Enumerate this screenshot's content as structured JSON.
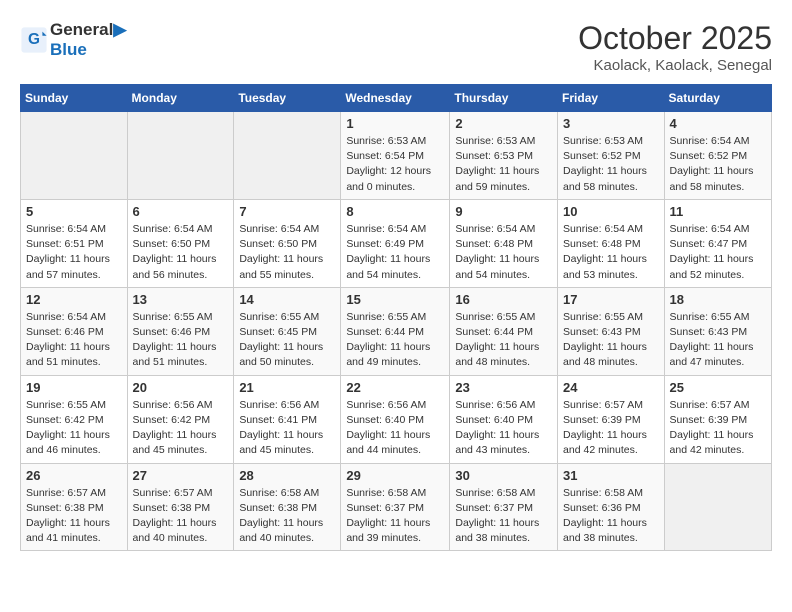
{
  "logo": {
    "line1": "General",
    "line2": "Blue"
  },
  "title": "October 2025",
  "location": "Kaolack, Kaolack, Senegal",
  "weekdays": [
    "Sunday",
    "Monday",
    "Tuesday",
    "Wednesday",
    "Thursday",
    "Friday",
    "Saturday"
  ],
  "weeks": [
    [
      {
        "day": "",
        "info": ""
      },
      {
        "day": "",
        "info": ""
      },
      {
        "day": "",
        "info": ""
      },
      {
        "day": "1",
        "info": "Sunrise: 6:53 AM\nSunset: 6:54 PM\nDaylight: 12 hours\nand 0 minutes."
      },
      {
        "day": "2",
        "info": "Sunrise: 6:53 AM\nSunset: 6:53 PM\nDaylight: 11 hours\nand 59 minutes."
      },
      {
        "day": "3",
        "info": "Sunrise: 6:53 AM\nSunset: 6:52 PM\nDaylight: 11 hours\nand 58 minutes."
      },
      {
        "day": "4",
        "info": "Sunrise: 6:54 AM\nSunset: 6:52 PM\nDaylight: 11 hours\nand 58 minutes."
      }
    ],
    [
      {
        "day": "5",
        "info": "Sunrise: 6:54 AM\nSunset: 6:51 PM\nDaylight: 11 hours\nand 57 minutes."
      },
      {
        "day": "6",
        "info": "Sunrise: 6:54 AM\nSunset: 6:50 PM\nDaylight: 11 hours\nand 56 minutes."
      },
      {
        "day": "7",
        "info": "Sunrise: 6:54 AM\nSunset: 6:50 PM\nDaylight: 11 hours\nand 55 minutes."
      },
      {
        "day": "8",
        "info": "Sunrise: 6:54 AM\nSunset: 6:49 PM\nDaylight: 11 hours\nand 54 minutes."
      },
      {
        "day": "9",
        "info": "Sunrise: 6:54 AM\nSunset: 6:48 PM\nDaylight: 11 hours\nand 54 minutes."
      },
      {
        "day": "10",
        "info": "Sunrise: 6:54 AM\nSunset: 6:48 PM\nDaylight: 11 hours\nand 53 minutes."
      },
      {
        "day": "11",
        "info": "Sunrise: 6:54 AM\nSunset: 6:47 PM\nDaylight: 11 hours\nand 52 minutes."
      }
    ],
    [
      {
        "day": "12",
        "info": "Sunrise: 6:54 AM\nSunset: 6:46 PM\nDaylight: 11 hours\nand 51 minutes."
      },
      {
        "day": "13",
        "info": "Sunrise: 6:55 AM\nSunset: 6:46 PM\nDaylight: 11 hours\nand 51 minutes."
      },
      {
        "day": "14",
        "info": "Sunrise: 6:55 AM\nSunset: 6:45 PM\nDaylight: 11 hours\nand 50 minutes."
      },
      {
        "day": "15",
        "info": "Sunrise: 6:55 AM\nSunset: 6:44 PM\nDaylight: 11 hours\nand 49 minutes."
      },
      {
        "day": "16",
        "info": "Sunrise: 6:55 AM\nSunset: 6:44 PM\nDaylight: 11 hours\nand 48 minutes."
      },
      {
        "day": "17",
        "info": "Sunrise: 6:55 AM\nSunset: 6:43 PM\nDaylight: 11 hours\nand 48 minutes."
      },
      {
        "day": "18",
        "info": "Sunrise: 6:55 AM\nSunset: 6:43 PM\nDaylight: 11 hours\nand 47 minutes."
      }
    ],
    [
      {
        "day": "19",
        "info": "Sunrise: 6:55 AM\nSunset: 6:42 PM\nDaylight: 11 hours\nand 46 minutes."
      },
      {
        "day": "20",
        "info": "Sunrise: 6:56 AM\nSunset: 6:42 PM\nDaylight: 11 hours\nand 45 minutes."
      },
      {
        "day": "21",
        "info": "Sunrise: 6:56 AM\nSunset: 6:41 PM\nDaylight: 11 hours\nand 45 minutes."
      },
      {
        "day": "22",
        "info": "Sunrise: 6:56 AM\nSunset: 6:40 PM\nDaylight: 11 hours\nand 44 minutes."
      },
      {
        "day": "23",
        "info": "Sunrise: 6:56 AM\nSunset: 6:40 PM\nDaylight: 11 hours\nand 43 minutes."
      },
      {
        "day": "24",
        "info": "Sunrise: 6:57 AM\nSunset: 6:39 PM\nDaylight: 11 hours\nand 42 minutes."
      },
      {
        "day": "25",
        "info": "Sunrise: 6:57 AM\nSunset: 6:39 PM\nDaylight: 11 hours\nand 42 minutes."
      }
    ],
    [
      {
        "day": "26",
        "info": "Sunrise: 6:57 AM\nSunset: 6:38 PM\nDaylight: 11 hours\nand 41 minutes."
      },
      {
        "day": "27",
        "info": "Sunrise: 6:57 AM\nSunset: 6:38 PM\nDaylight: 11 hours\nand 40 minutes."
      },
      {
        "day": "28",
        "info": "Sunrise: 6:58 AM\nSunset: 6:38 PM\nDaylight: 11 hours\nand 40 minutes."
      },
      {
        "day": "29",
        "info": "Sunrise: 6:58 AM\nSunset: 6:37 PM\nDaylight: 11 hours\nand 39 minutes."
      },
      {
        "day": "30",
        "info": "Sunrise: 6:58 AM\nSunset: 6:37 PM\nDaylight: 11 hours\nand 38 minutes."
      },
      {
        "day": "31",
        "info": "Sunrise: 6:58 AM\nSunset: 6:36 PM\nDaylight: 11 hours\nand 38 minutes."
      },
      {
        "day": "",
        "info": ""
      }
    ]
  ]
}
